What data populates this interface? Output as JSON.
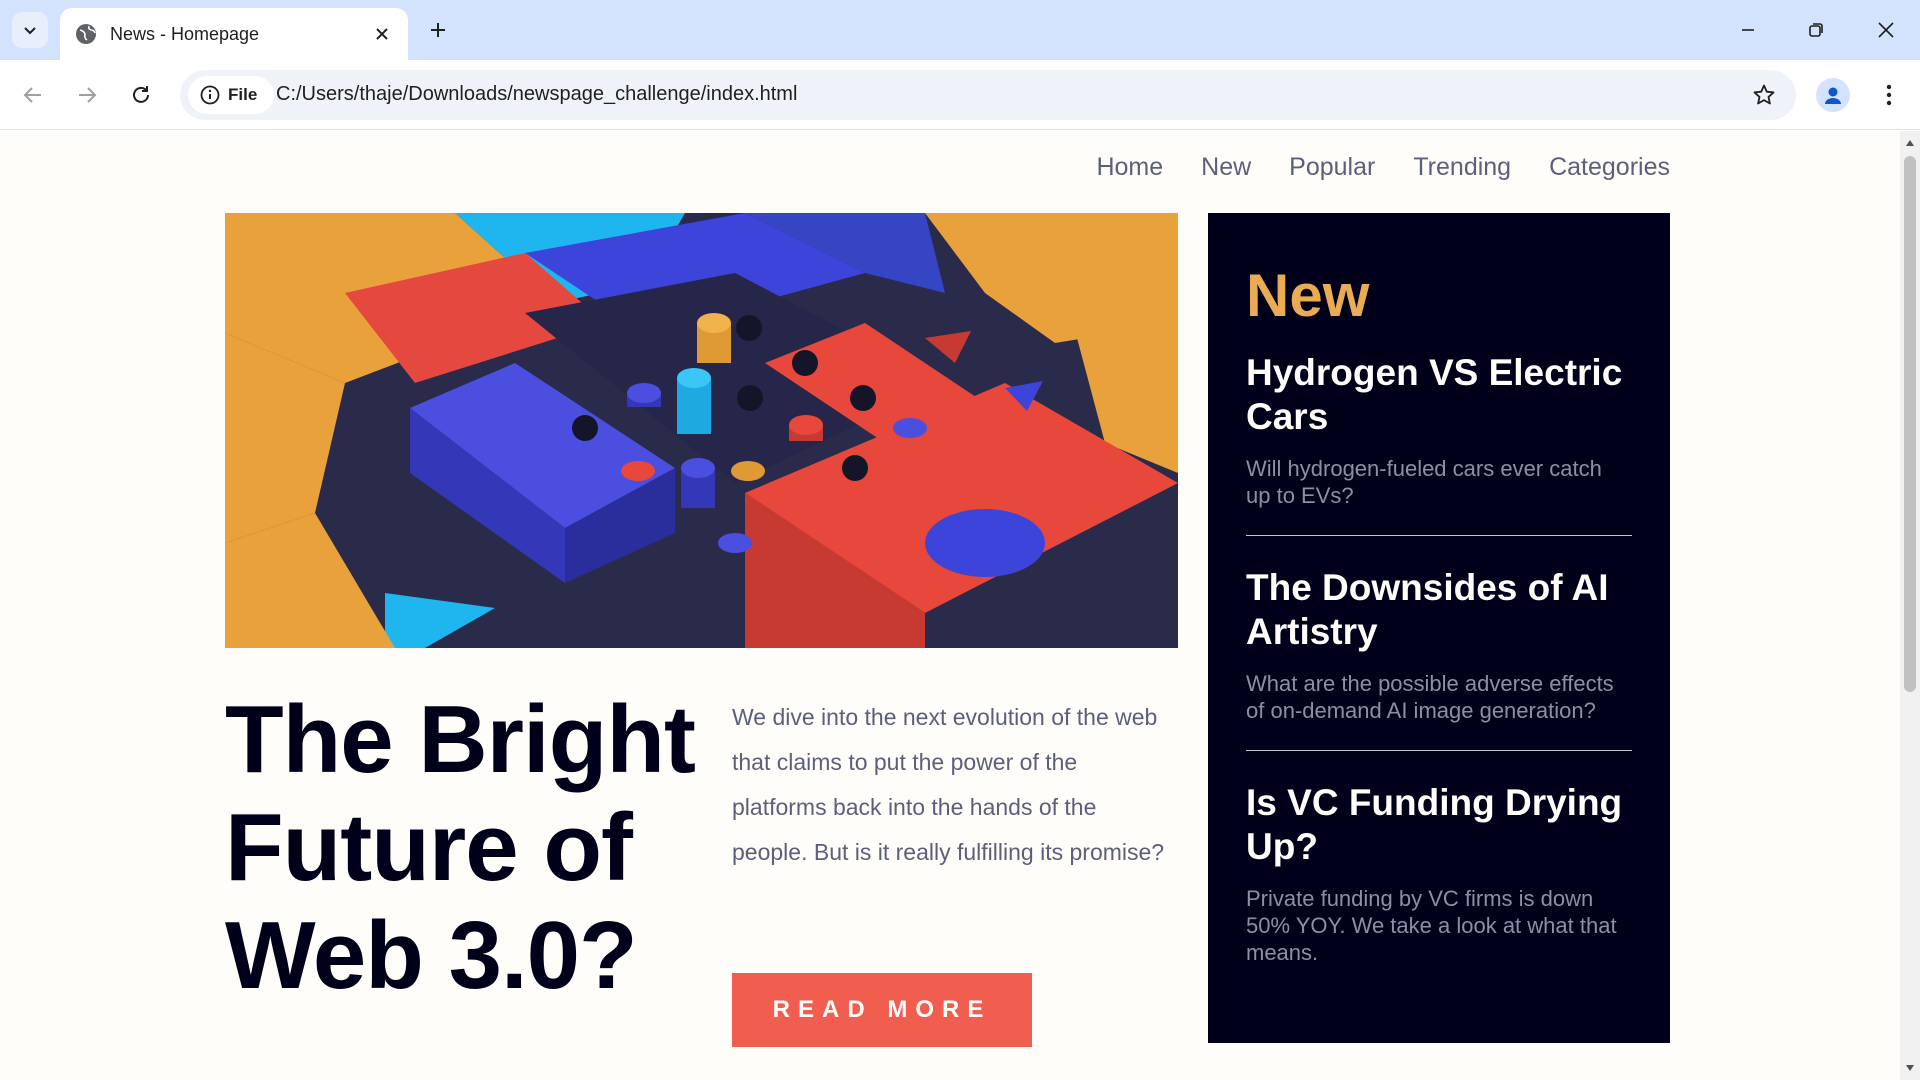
{
  "browser": {
    "tab_title": "News - Homepage",
    "site_chip_label": "File",
    "url": "C:/Users/thaje/Downloads/newspage_challenge/index.html",
    "icons": [
      "tab-search-icon",
      "globe-icon",
      "close-icon",
      "plus-icon",
      "minimize-icon",
      "restore-icon",
      "back-icon",
      "forward-icon",
      "reload-icon",
      "info-icon",
      "star-icon",
      "profile-icon",
      "kebab-menu-icon"
    ]
  },
  "page": {
    "nav": [
      "Home",
      "New",
      "Popular",
      "Trending",
      "Categories"
    ],
    "hero": {
      "headline": "The Bright Future of Web 3.0?",
      "lede": "We dive into the next evolution of the web that claims to put the power of the platforms back into the hands of the people. But is it really fulfilling its promise?",
      "cta": "READ MORE"
    },
    "new_panel": {
      "title": "New",
      "items": [
        {
          "title": "Hydrogen VS Electric Cars",
          "desc": "Will hydrogen-fueled cars ever catch up to EVs?"
        },
        {
          "title": "The Downsides of AI Artistry",
          "desc": "What are the possible adverse effects of on-demand AI image generation?"
        },
        {
          "title": "Is VC Funding Drying Up?",
          "desc": "Private funding by VC firms is down 50% YOY. We take a look at what that means."
        }
      ]
    },
    "colors": {
      "background": "#fffdfa",
      "soft_red": "#f15e50",
      "soft_orange": "#e9ab53",
      "very_dark_blue": "#00001a",
      "grayish_blue": "#5d5f79"
    }
  }
}
